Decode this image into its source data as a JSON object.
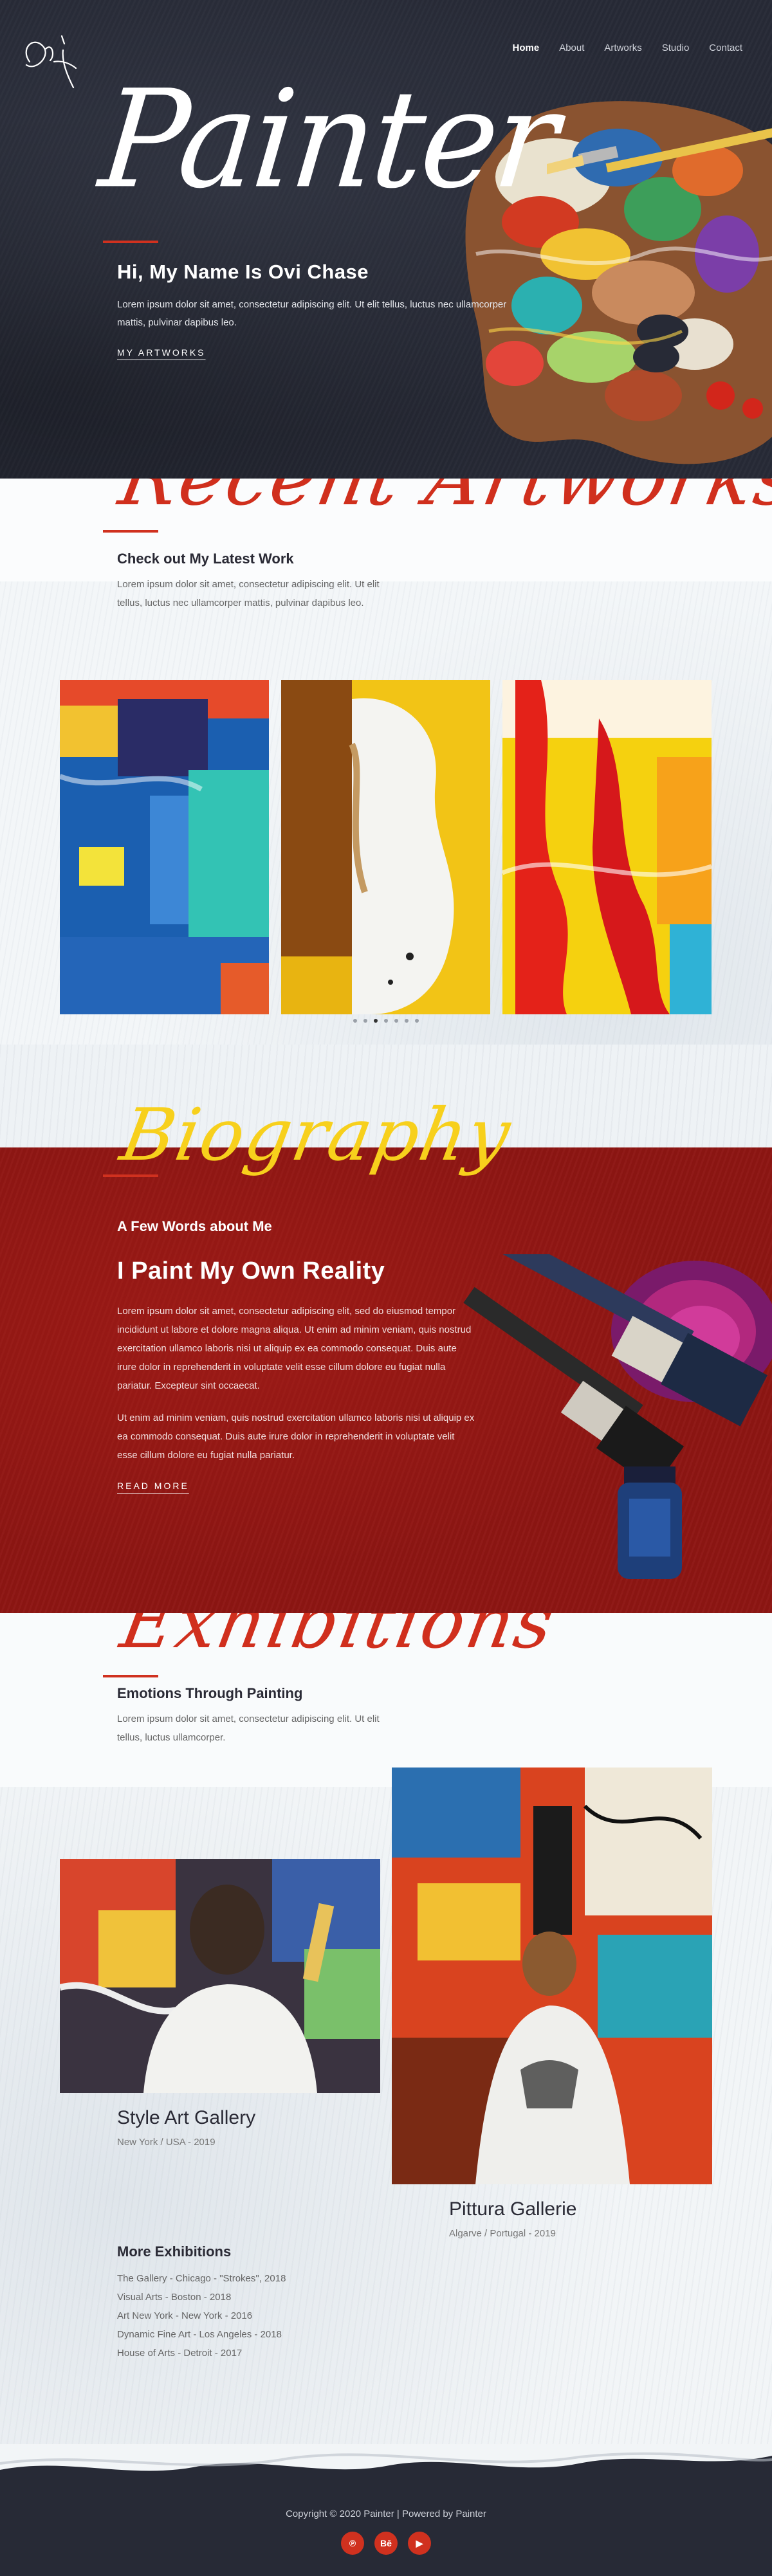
{
  "nav": {
    "items": [
      "Home",
      "About",
      "Artworks",
      "Studio",
      "Contact"
    ]
  },
  "hero": {
    "title": "Painter",
    "heading": "Hi, My Name Is Ovi Chase",
    "text": "Lorem ipsum dolor sit amet, consectetur adipiscing elit. Ut elit tellus, luctus nec ullamcorper mattis, pulvinar dapibus leo.",
    "link": "MY ARTWORKS"
  },
  "artworks": {
    "title": "Recent Artworks",
    "subtitle": "Check out My Latest Work",
    "text": "Lorem ipsum dolor sit amet, consectetur adipiscing elit. Ut elit tellus, luctus nec ullamcorper mattis, pulvinar dapibus leo.",
    "slider_dots": 7,
    "active_dot": 2
  },
  "bio": {
    "title": "Biography",
    "subtitle": "A Few Words about Me",
    "heading": "I Paint My Own Reality",
    "text1": "Lorem ipsum dolor sit amet, consectetur adipiscing elit, sed do eiusmod tempor incididunt ut labore et dolore magna aliqua. Ut enim ad minim veniam, quis nostrud exercitation ullamco laboris nisi ut aliquip ex ea commodo consequat. Duis aute irure dolor in reprehenderit in voluptate velit esse cillum dolore eu fugiat nulla pariatur. Excepteur sint occaecat.",
    "text2": "Ut enim ad minim veniam, quis nostrud exercitation ullamco laboris nisi ut aliquip ex ea commodo consequat. Duis aute irure dolor in reprehenderit in voluptate velit esse cillum dolore eu fugiat nulla pariatur.",
    "link": "READ MORE"
  },
  "exhibitions": {
    "title": "Exhibitions",
    "subtitle": "Emotions Through Painting",
    "text": "Lorem ipsum dolor sit amet, consectetur adipiscing elit. Ut elit tellus, luctus ullamcorper.",
    "gallery1": {
      "name": "Style Art Gallery",
      "location": "New York / USA - 2019"
    },
    "gallery2": {
      "name": "Pittura Gallerie",
      "location": "Algarve / Portugal - 2019"
    },
    "more_title": "More Exhibitions",
    "more": [
      "The Gallery - Chicago - \"Strokes\", 2018",
      "Visual Arts - Boston - 2018",
      "Art New York - New York - 2016",
      "Dynamic Fine Art - Los Angeles - 2018",
      "House of Arts - Detroit - 2017"
    ]
  },
  "footer": {
    "copyright": "Copyright © 2020 Painter | Powered by Painter",
    "socials": [
      "pinterest-icon",
      "behance-icon",
      "youtube-icon"
    ],
    "social_glyphs": [
      "℗",
      "Bē",
      "▶"
    ]
  },
  "colors": {
    "dark": "#272a36",
    "accent_red": "#d0311f",
    "bio_red": "#8e1613",
    "bio_yellow": "#f7d01c"
  }
}
